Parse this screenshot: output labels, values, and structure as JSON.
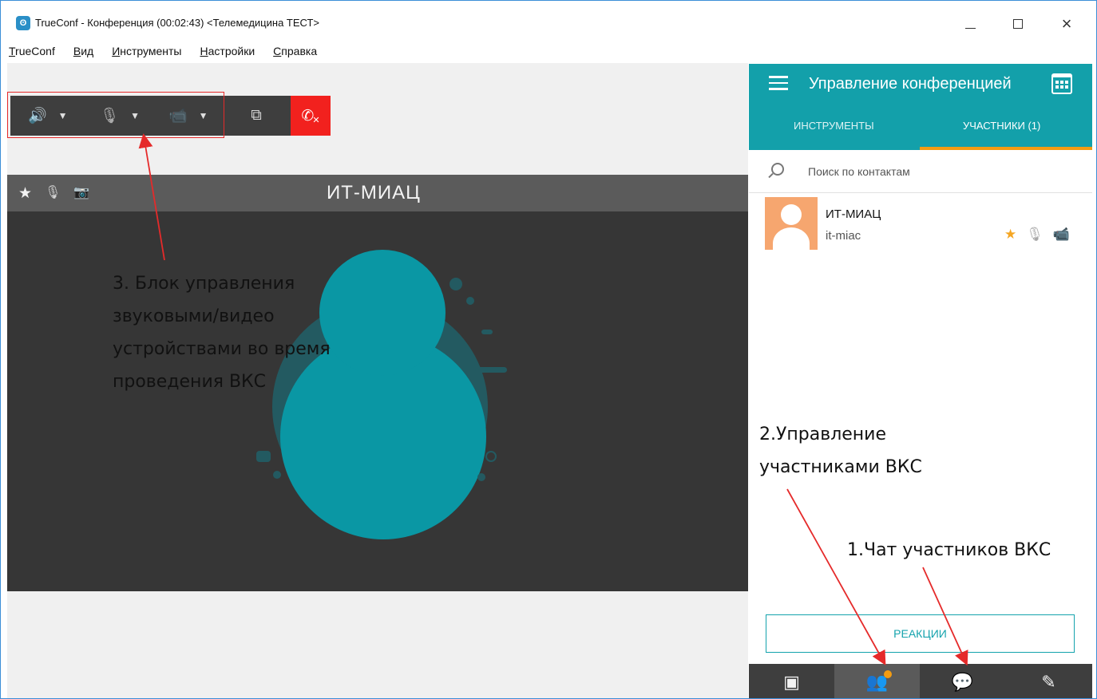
{
  "window": {
    "logo_glyph": "ʘ",
    "title": "TrueConf - Конференция (00:02:43) <Телемедицина ТЕСТ>",
    "minimize_glyph": "",
    "close_glyph": "×"
  },
  "menu": {
    "items": [
      {
        "first": "T",
        "rest": "rueConf"
      },
      {
        "first": "В",
        "rest": "ид"
      },
      {
        "first": "И",
        "rest": "нструменты"
      },
      {
        "first": "Н",
        "rest": "астройки"
      },
      {
        "first": "С",
        "rest": "правка"
      }
    ]
  },
  "toolbar": {
    "speaker_icon": "🔊",
    "mic_icon": "🎙",
    "camera_icon": "📹",
    "share_icon": "⧉",
    "hangup_icon": "✆",
    "hangup_x": "✕",
    "caret": "▼"
  },
  "video": {
    "participant_name": "ИТ-МИАЦ",
    "star_icon": "★",
    "mute_icon": "🎙",
    "cam_off_icon": "📷"
  },
  "annotations": {
    "block3": [
      "3. Блок управления",
      "звуковыми/видео",
      "устройствами во время",
      "проведения ВКС"
    ],
    "block2": [
      "2.Управление",
      "участниками ВКС"
    ],
    "block1": "1.Чат участников ВКС"
  },
  "panel": {
    "title": "Управление конференцией",
    "tab_tools": "ИНСТРУМЕНТЫ",
    "tab_participants": "УЧАСТНИКИ (1)",
    "search_placeholder": "Поиск по контактам",
    "contact": {
      "name": "ИТ-МИАЦ",
      "login": "it-miac",
      "star_icon": "★",
      "mute_icon": "🎙",
      "cam_icon": "📹"
    },
    "reactions_label": "РЕАКЦИИ",
    "bottom": {
      "contacts_icon": "▣",
      "participants_icon": "👥",
      "chat_icon": "💬",
      "hangup_icon": "✎"
    }
  },
  "colors": {
    "accent": "#13a0aa",
    "hangup": "#f2211e",
    "annotation_red": "#e52a2a",
    "tab_underline": "#f39c12",
    "avatar": "#f6a66f"
  }
}
